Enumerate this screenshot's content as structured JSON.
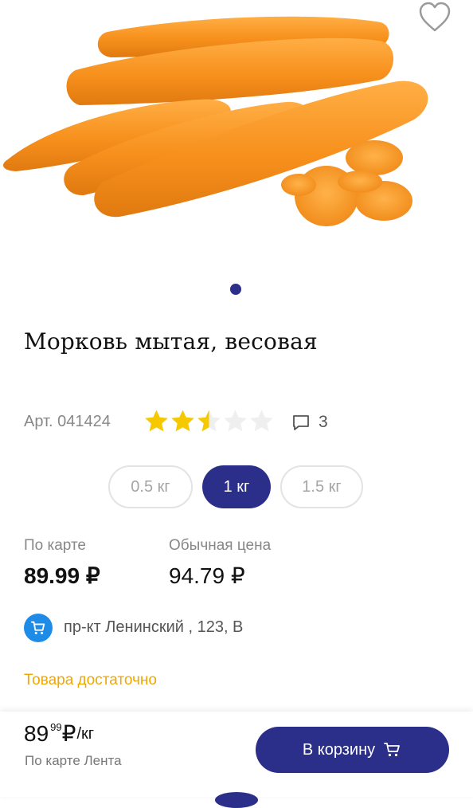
{
  "product": {
    "title": "Морковь мытая, весовая",
    "article": "Арт. 041424",
    "rating": 2.5,
    "rating_max": 5,
    "reviews_count": "3",
    "image_icon": "carrots-image"
  },
  "weights": [
    {
      "label": "0.5 кг",
      "selected": false
    },
    {
      "label": "1 кг",
      "selected": true
    },
    {
      "label": "1.5 кг",
      "selected": false
    }
  ],
  "price": {
    "card_label": "По карте",
    "card_value": "89.99 ₽",
    "regular_label": "Обычная цена",
    "regular_value": "94.79 ₽"
  },
  "store": {
    "address": "пр-кт Ленинский , 123, В",
    "icon": "cart-icon"
  },
  "stock_status": "Товара достаточно",
  "bottom_bar": {
    "price_int": "89",
    "price_frac": "99",
    "currency": "₽",
    "unit": "/кг",
    "card_note": "По карте Лента",
    "cart_label": "В корзину"
  },
  "colors": {
    "accent": "#2b2f8a",
    "star": "#f5c800",
    "store_icon": "#1e8be6",
    "stock": "#f0a800"
  }
}
